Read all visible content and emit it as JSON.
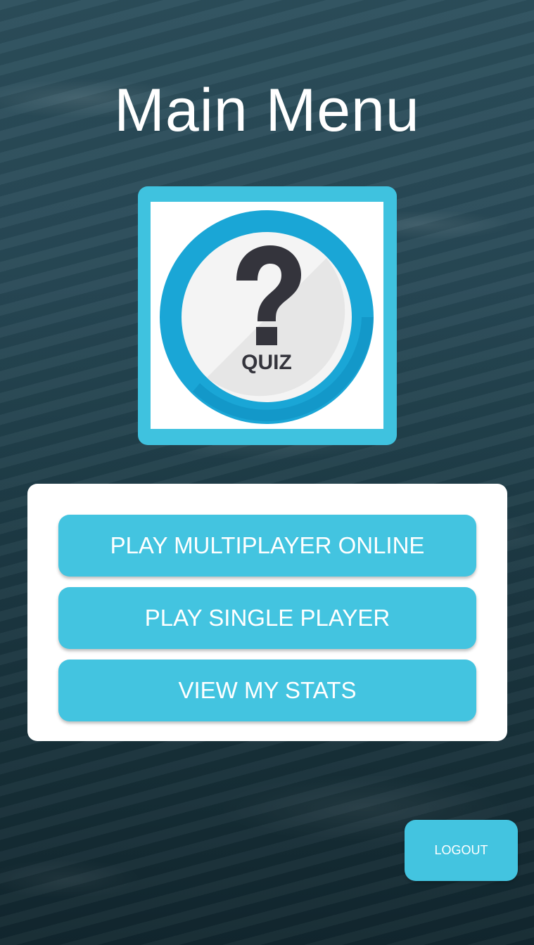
{
  "screen": {
    "title": "Main Menu"
  },
  "logo": {
    "icon": "question-mark-icon",
    "text": "QUIZ",
    "frame_color": "#3fc2df",
    "ring_color": "#1aa6d6"
  },
  "menu": {
    "buttons": [
      {
        "label": "PLAY MULTIPLAYER ONLINE"
      },
      {
        "label": "PLAY SINGLE PLAYER"
      },
      {
        "label": "VIEW MY STATS"
      }
    ],
    "button_color": "#43c4e0"
  },
  "footer": {
    "logout_label": "LOGOUT"
  }
}
